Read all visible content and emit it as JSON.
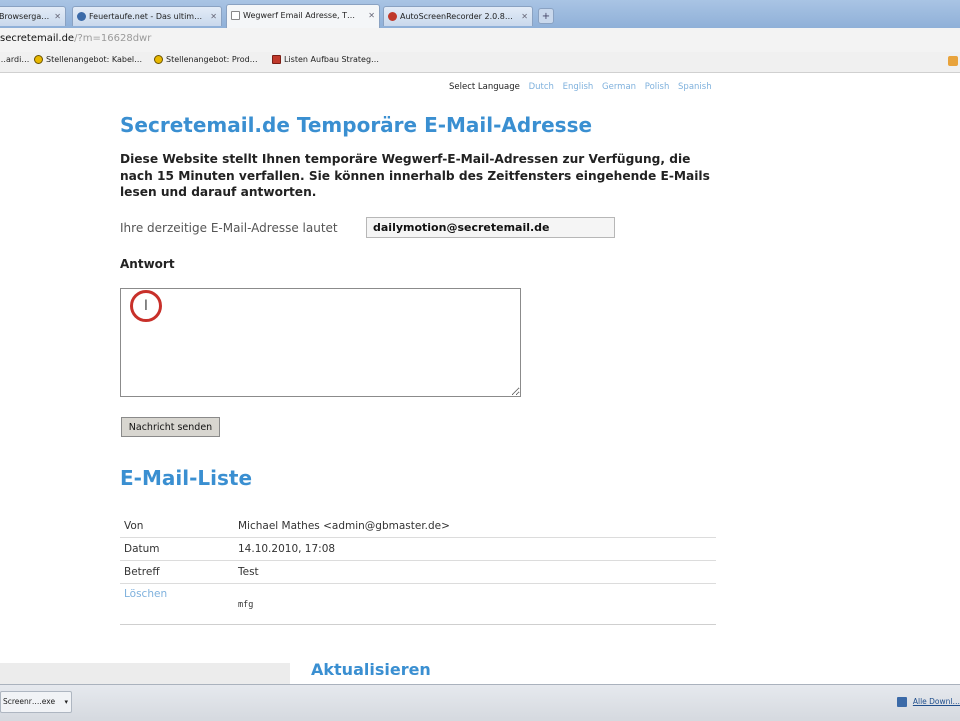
{
  "browser": {
    "tabs": [
      {
        "label": "Browserga…",
        "color": "#888888"
      },
      {
        "label": "Feuertaufe.net - Das ultim…",
        "color": "#3b6aa8"
      },
      {
        "label": "Wegwerf Email Adresse, T…",
        "color": "#ffffff",
        "active": true
      },
      {
        "label": "AutoScreenRecorder 2.0.8…",
        "color": "#c0392b"
      }
    ],
    "new_tab_symbol": "+",
    "url_host": "secretemail.de",
    "url_rest": "/?m=16628dwr",
    "bookmarks": [
      {
        "label": "…ardi…"
      },
      {
        "label": "Stellenangebot: Kabel…"
      },
      {
        "label": "Stellenangebot: Prod…"
      },
      {
        "label": "Listen Aufbau Strateg…"
      }
    ]
  },
  "language": {
    "label": "Select Language",
    "options": [
      "Dutch",
      "English",
      "German",
      "Polish",
      "Spanish"
    ]
  },
  "page": {
    "title": "Secretemail.de Temporäre E-Mail-Adresse",
    "intro": "Diese Website stellt Ihnen temporäre Wegwerf-E-Mail-Adressen zur Verfügung, die nach 15 Minuten verfallen. Sie können innerhalb des Zeitfensters eingehende E-Mails lesen und darauf antworten.",
    "address_label": "Ihre derzeitige E-Mail-Adresse lautet",
    "address_value": "dailymotion@secretemail.de",
    "reply_label": "Antwort",
    "reply_value": "",
    "send_button": "Nachricht senden"
  },
  "mail_list": {
    "title": "E-Mail-Liste",
    "rows": [
      {
        "key": "Von",
        "value": "Michael Mathes <admin@gbmaster.de>"
      },
      {
        "key": "Datum",
        "value": "14.10.2010, 17:08"
      },
      {
        "key": "Betreff",
        "value": "Test"
      }
    ],
    "delete_label": "Löschen",
    "body": "mfg",
    "refresh_label": "Aktualisieren"
  },
  "download_bar": {
    "item_label": "Screenr….exe",
    "item_arrow": "▾",
    "show_all_label": "Alle Downl…"
  }
}
